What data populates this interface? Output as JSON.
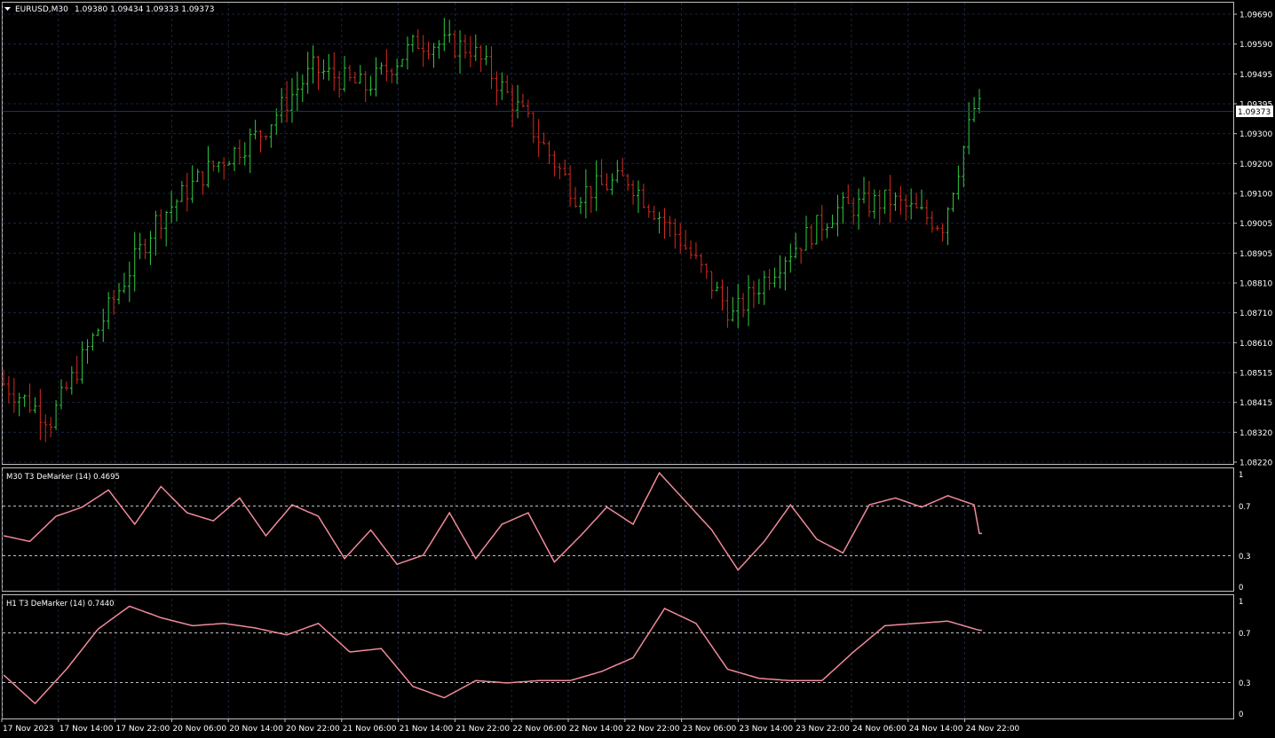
{
  "chart_header": {
    "symbol": "EURUSD,M30",
    "ohlc": "1.09380 1.09434 1.09333 1.09373"
  },
  "colors": {
    "background": "#000000",
    "grid": "#1f2b4d",
    "bull": "#2ecc40",
    "bear": "#d42a20",
    "indicator": "#f08a9a",
    "level_line": "#1a2a8a",
    "axis": "#c0c0c0"
  },
  "price_axis": {
    "ticks": [
      "1.09690",
      "1.09590",
      "1.09495",
      "1.09395",
      "1.09300",
      "1.09200",
      "1.09100",
      "1.09005",
      "1.08905",
      "1.08810",
      "1.08710",
      "1.08610",
      "1.08515",
      "1.08415",
      "1.08320",
      "1.08220"
    ],
    "current_price": "1.09373"
  },
  "time_axis": {
    "ticks": [
      "17 Nov 2023",
      "17 Nov 14:00",
      "17 Nov 22:00",
      "20 Nov 06:00",
      "20 Nov 14:00",
      "20 Nov 22:00",
      "21 Nov 06:00",
      "21 Nov 14:00",
      "21 Nov 22:00",
      "22 Nov 06:00",
      "22 Nov 14:00",
      "22 Nov 22:00",
      "23 Nov 06:00",
      "23 Nov 14:00",
      "23 Nov 22:00",
      "24 Nov 06:00",
      "24 Nov 14:00",
      "24 Nov 22:00"
    ]
  },
  "indicator_panels": [
    {
      "title": "M30 T3 DeMarker (14) 0.4695",
      "levels": [
        "1",
        "0.7",
        "0.3",
        "0"
      ]
    },
    {
      "title": "H1 T3 DeMarker (14) 0.7440",
      "levels": [
        "1",
        "0.7",
        "0.3",
        "0"
      ]
    }
  ],
  "chart_data": [
    {
      "type": "line",
      "name": "EURUSD M30 price",
      "ylim": [
        1.0822,
        1.0969
      ],
      "x": [
        0,
        10,
        20,
        30,
        40,
        50,
        60,
        70,
        80,
        90,
        100,
        110,
        120,
        130,
        140,
        150,
        160,
        170,
        180,
        186
      ],
      "values": [
        1.0849,
        1.0836,
        1.0869,
        1.0901,
        1.0918,
        1.093,
        1.0951,
        1.0945,
        1.096,
        1.0958,
        1.0936,
        1.091,
        1.0915,
        1.0895,
        1.087,
        1.089,
        1.0905,
        1.0908,
        1.09,
        1.0938
      ]
    },
    {
      "type": "line",
      "series": [
        {
          "name": "M30 T3 DeMarker (14)"
        }
      ],
      "ylim": [
        0,
        1
      ],
      "x": [
        0,
        5,
        10,
        15,
        20,
        25,
        30,
        35,
        40,
        45,
        50,
        55,
        60,
        65,
        70,
        75,
        80,
        85,
        90,
        95,
        100,
        105,
        110,
        115,
        120,
        125,
        130,
        135,
        140,
        145,
        150,
        155,
        160,
        165,
        170,
        175,
        180,
        185,
        186
      ],
      "values": [
        0.45,
        0.4,
        0.62,
        0.7,
        0.85,
        0.55,
        0.88,
        0.65,
        0.58,
        0.78,
        0.45,
        0.72,
        0.62,
        0.25,
        0.5,
        0.2,
        0.28,
        0.65,
        0.25,
        0.55,
        0.65,
        0.22,
        0.45,
        0.7,
        0.55,
        1.0,
        0.75,
        0.5,
        0.15,
        0.4,
        0.72,
        0.42,
        0.3,
        0.72,
        0.78,
        0.7,
        0.8,
        0.72,
        0.47
      ]
    },
    {
      "type": "line",
      "series": [
        {
          "name": "H1 T3 DeMarker (14)"
        }
      ],
      "ylim": [
        0,
        1
      ],
      "x": [
        0,
        6,
        12,
        18,
        24,
        30,
        36,
        42,
        48,
        54,
        60,
        66,
        72,
        78,
        84,
        90,
        96,
        102,
        108,
        114,
        120,
        126,
        132,
        138,
        144,
        150,
        156,
        162,
        168,
        174,
        180,
        186
      ],
      "values": [
        0.35,
        0.1,
        0.4,
        0.75,
        0.95,
        0.85,
        0.78,
        0.8,
        0.76,
        0.7,
        0.8,
        0.55,
        0.58,
        0.25,
        0.15,
        0.3,
        0.28,
        0.3,
        0.3,
        0.38,
        0.5,
        0.93,
        0.8,
        0.4,
        0.32,
        0.3,
        0.3,
        0.55,
        0.78,
        0.8,
        0.82,
        0.74
      ]
    }
  ]
}
